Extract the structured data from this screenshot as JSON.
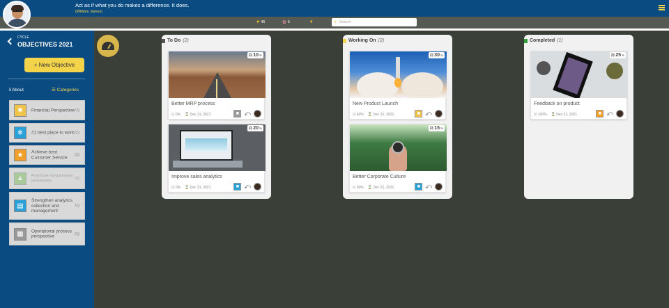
{
  "header": {
    "quote": "Act as if what you do makes a difference. It does.",
    "user_name": "(William James)"
  },
  "stats": {
    "coins": "46",
    "rewards": "5",
    "search_placeholder": "Search"
  },
  "sidebar": {
    "cycle_label": "CYCLE",
    "cycle_title": "OBJECTIVES 2021",
    "new_objective": "+ New Objective",
    "about": "About",
    "categories": "Categories",
    "category_list": [
      {
        "label": "Financial Perspective",
        "count": "(1)",
        "color": "#f0c44a",
        "faded": false
      },
      {
        "label": "#1 best place to work",
        "count": "(1)",
        "color": "#2aa0d8",
        "faded": false
      },
      {
        "label": "Achieve best Customer Service",
        "count": "(1)",
        "color": "#f0a02a",
        "faded": false
      },
      {
        "label": "Promote sustainable processes",
        "count": "(0)",
        "color": "#7cbf5a",
        "faded": true
      },
      {
        "label": "Strengthen analytics collection and management",
        "count": "(1)",
        "color": "#2aa0d8",
        "faded": false
      },
      {
        "label": "Operational process perspective",
        "count": "(1)",
        "color": "#999999",
        "faded": false
      }
    ]
  },
  "columns": [
    {
      "name": "To Do",
      "count": "(2)",
      "color": "#555555",
      "cards": [
        {
          "title": "Better MRP process",
          "percent": "10",
          "progress": "0%",
          "date": "Dec 31, 2021",
          "cat_color": "#999999",
          "img": "road"
        },
        {
          "title": "Improve sales analytics",
          "percent": "20",
          "progress": "0%",
          "date": "Dec 31, 2021",
          "cat_color": "#2aa0d8",
          "img": "laptop"
        }
      ]
    },
    {
      "name": "Working On",
      "count": "(2)",
      "color": "#f3d34a",
      "cards": [
        {
          "title": "New Product Launch",
          "percent": "30",
          "progress": "40%",
          "date": "Dec 31, 2021",
          "cat_color": "#f0c44a",
          "img": "rocket"
        },
        {
          "title": "Better Corporate Culture",
          "percent": "15",
          "progress": "50%",
          "date": "Dec 31, 2021",
          "cat_color": "#2aa0d8",
          "img": "forest"
        }
      ]
    },
    {
      "name": "Completed",
      "count": "(1)",
      "color": "#2e9d3a",
      "cards": [
        {
          "title": "Feedback on product",
          "percent": "25",
          "progress": "100%",
          "date": "Dec 31, 2021",
          "cat_color": "#f0a02a",
          "img": "phone"
        }
      ]
    }
  ]
}
